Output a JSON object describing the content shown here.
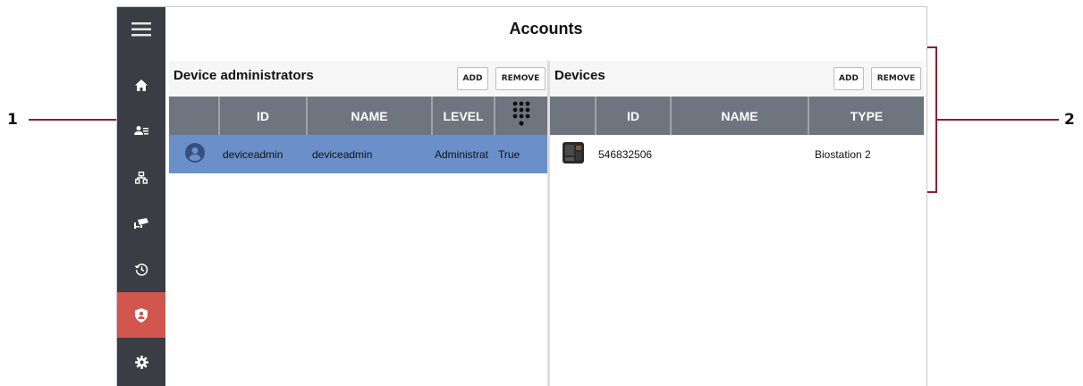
{
  "callouts": [
    "1",
    "2"
  ],
  "sidebar": {
    "items": [
      {
        "icon": "menu-icon",
        "active": false
      },
      {
        "icon": "home-icon",
        "active": false
      },
      {
        "icon": "users-icon",
        "active": false
      },
      {
        "icon": "network-icon",
        "active": false
      },
      {
        "icon": "cctv-camera-icon",
        "active": false
      },
      {
        "icon": "history-icon",
        "active": false
      },
      {
        "icon": "shield-user-icon",
        "active": true
      },
      {
        "icon": "gear-icon",
        "active": false
      }
    ],
    "active_color": "#d0564e",
    "background": "#3a3d43"
  },
  "page": {
    "title": "Accounts"
  },
  "admins": {
    "title": "Device administrators",
    "add_label": "ADD",
    "remove_label": "REMOVE",
    "columns": [
      "ID",
      "NAME",
      "LEVEL"
    ],
    "rows": [
      {
        "id": "deviceadmin",
        "name": "deviceadmin",
        "level": "Administrat",
        "extra": "True",
        "selected": true
      }
    ]
  },
  "devices": {
    "title": "Devices",
    "add_label": "ADD",
    "remove_label": "REMOVE",
    "columns": [
      "ID",
      "NAME",
      "TYPE"
    ],
    "rows": [
      {
        "id": "546832506",
        "name": "",
        "type": "Biostation 2"
      }
    ]
  }
}
